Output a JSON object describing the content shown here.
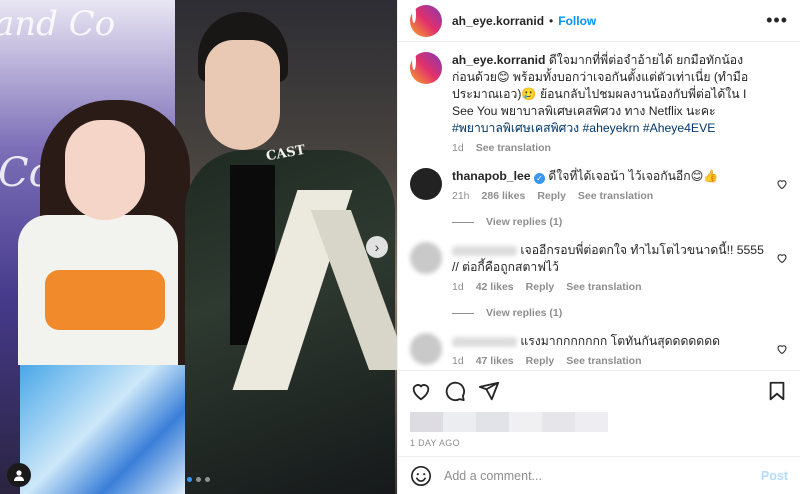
{
  "post": {
    "username": "ah_eye.korranid",
    "separator": "•",
    "follow_label": "Follow",
    "more_label": "•••",
    "nav_arrow": "›",
    "carousel_dots": 3,
    "active_dot": 0
  },
  "photo": {
    "jacket_text": "CAST",
    "sign_text_1": "and Co",
    "sign_text_2": "Co"
  },
  "caption": {
    "username": "ah_eye.korranid",
    "text": " ดีใจมากที่พี่ต่อจำอ้ายได้ ยกมือทักน้องก่อนด้วย😊 พร้อมทั้งบอกว่าเจอกันตั้งแต่ตัวเท่าเนี่ย (ทำมือประมาณเอว)🥲 ย้อนกลับไปชมผลงานน้องกับพี่ต่อได้ใน I See You พยาบาลพิเศษเคสพิศวง ทาง Netflix นะคะ ",
    "tags": "#พยาบาลพิเศษเคสพิศวง #aheyekrn #Aheye4EVE",
    "time": "1d",
    "see_translation": "See translation"
  },
  "comments": [
    {
      "username": "thanapob_lee",
      "verified": true,
      "text": "ดีใจที่ได้เจอน้า ไว้เจอกันอีก😊👍",
      "time": "21h",
      "likes": "286 likes",
      "reply": "Reply",
      "see_translation": "See translation",
      "view_replies": "View replies (1)"
    },
    {
      "username": "",
      "verified": false,
      "text": "เจออีกรอบพี่ต่อตกใจ ทำไมโตไวขนาดนี้!! 5555 // ต่อกี้คือถูกสตาฟไว้",
      "time": "1d",
      "likes": "42 likes",
      "reply": "Reply",
      "see_translation": "See translation",
      "view_replies": "View replies (1)"
    },
    {
      "username": "",
      "verified": false,
      "text": "แรงมากกกกกกก โตทันกันสุดดดดดดด",
      "time": "1d",
      "likes": "47 likes",
      "reply": "Reply",
      "see_translation": "See translation",
      "view_replies": ""
    }
  ],
  "footer": {
    "date": "1 DAY AGO",
    "add_comment_placeholder": "Add a comment...",
    "post_label": "Post"
  },
  "colors": {
    "accent": "#0095f6",
    "hashtag": "#00376b",
    "muted": "#8e8e8e",
    "post_disabled": "#b3dbff"
  }
}
